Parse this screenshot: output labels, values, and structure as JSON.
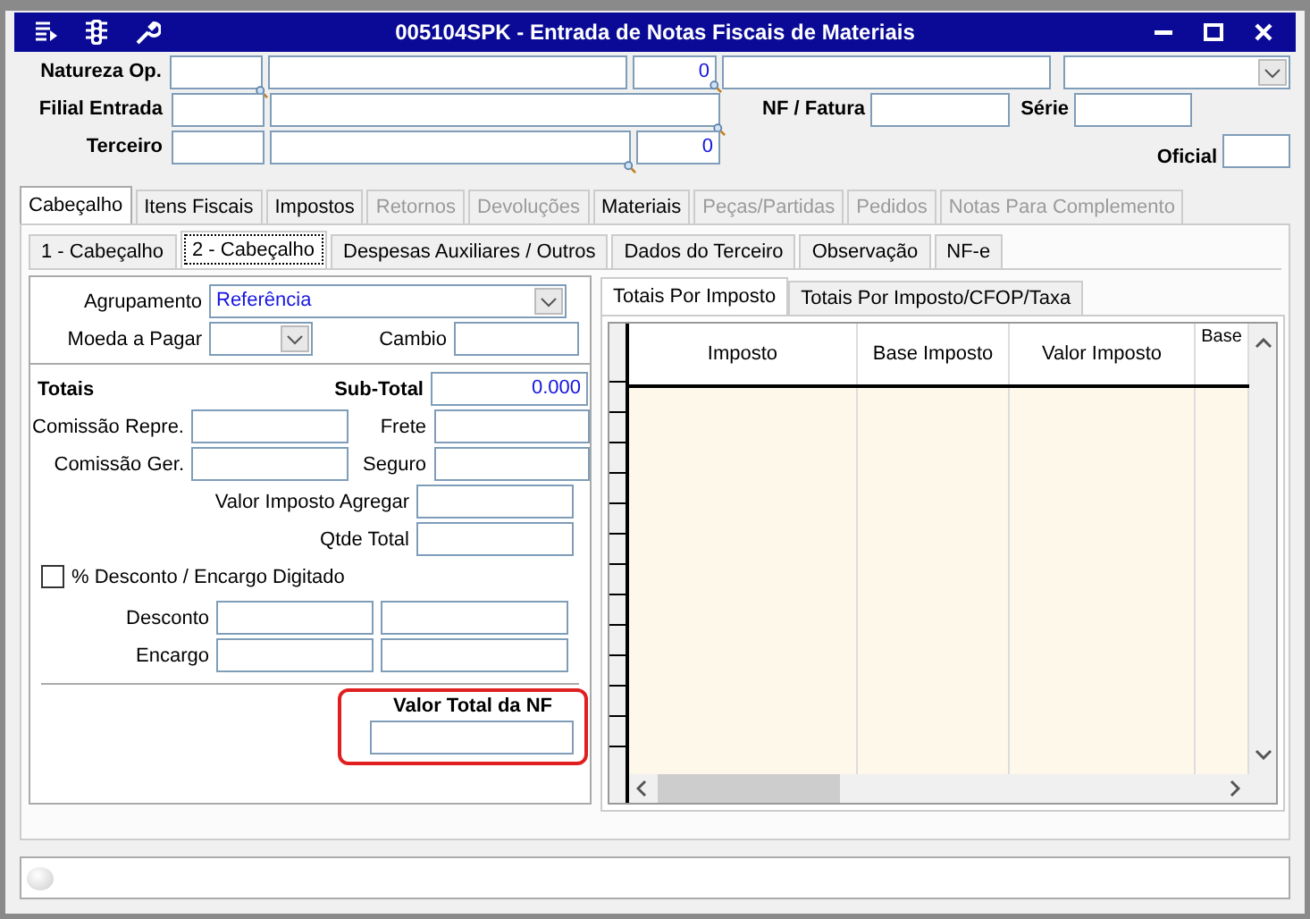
{
  "window": {
    "title": "005104SPK - Entrada de Notas Fiscais de Materiais"
  },
  "header": {
    "natureza_label": "Natureza Op.",
    "natureza_number": "0",
    "filial_label": "Filial Entrada",
    "nf_label": "NF / Fatura",
    "serie_label": "Série",
    "terceiro_label": "Terceiro",
    "terceiro_number": "0",
    "oficial_label": "Oficial"
  },
  "tabs": [
    {
      "label": "Cabeçalho",
      "selected": true,
      "disabled": false
    },
    {
      "label": "Itens Fiscais",
      "selected": false,
      "disabled": false
    },
    {
      "label": "Impostos",
      "selected": false,
      "disabled": false
    },
    {
      "label": "Retornos",
      "selected": false,
      "disabled": true
    },
    {
      "label": "Devoluções",
      "selected": false,
      "disabled": true
    },
    {
      "label": "Materiais",
      "selected": false,
      "disabled": false
    },
    {
      "label": "Peças/Partidas",
      "selected": false,
      "disabled": true
    },
    {
      "label": "Pedidos",
      "selected": false,
      "disabled": true
    },
    {
      "label": "Notas Para Complemento",
      "selected": false,
      "disabled": true
    }
  ],
  "subtabs": [
    {
      "label": "1 - Cabeçalho",
      "selected": false
    },
    {
      "label": "2 - Cabeçalho",
      "selected": true
    },
    {
      "label": "Despesas Auxiliares / Outros",
      "selected": false
    },
    {
      "label": "Dados do Terceiro",
      "selected": false
    },
    {
      "label": "Observação",
      "selected": false
    },
    {
      "label": "NF-e",
      "selected": false
    }
  ],
  "form": {
    "agrupamento_label": "Agrupamento",
    "agrupamento_value": "Referência",
    "moeda_label": "Moeda a Pagar",
    "cambio_label": "Cambio",
    "totais_label": "Totais",
    "subtotal_label": "Sub-Total",
    "subtotal_value": "0.000",
    "comissao_repre_label": "Comissão Repre.",
    "frete_label": "Frete",
    "comissao_ger_label": "Comissão Ger.",
    "seguro_label": "Seguro",
    "valor_imposto_label": "Valor Imposto Agregar",
    "qtde_label": "Qtde Total",
    "desconto_checkbox": {
      "label": "% Desconto / Encargo Digitado",
      "checked": false
    },
    "desconto_label": "Desconto",
    "encargo_label": "Encargo",
    "valor_total_label": "Valor Total da NF"
  },
  "grid_tabs": [
    {
      "label": "Totais Por Imposto",
      "selected": true
    },
    {
      "label": "Totais Por Imposto/CFOP/Taxa",
      "selected": false
    }
  ],
  "table": {
    "columns": [
      "Imposto",
      "Base Imposto",
      "Valor Imposto",
      "Base"
    ]
  }
}
